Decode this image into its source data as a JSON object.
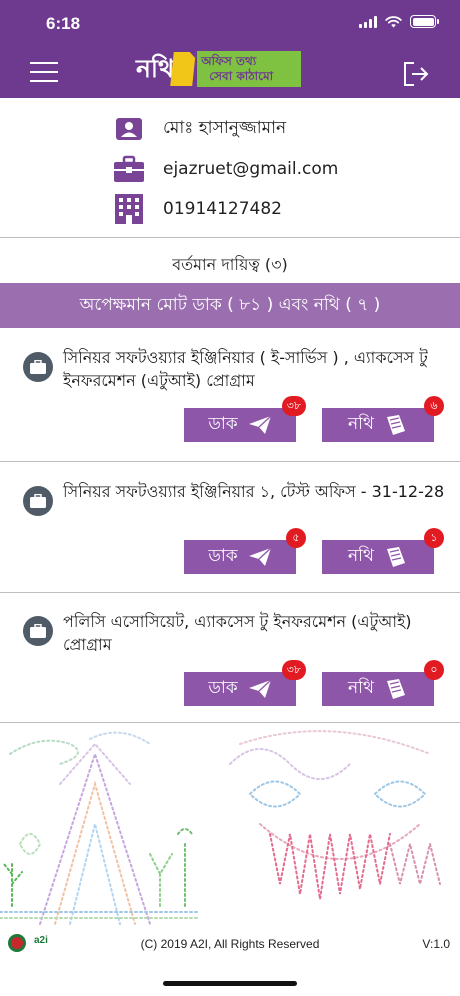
{
  "status_bar": {
    "time": "6:18"
  },
  "header": {
    "logo_main": "নথি",
    "logo_line1": "অফিস তথ্য",
    "logo_line2": "সেবা কাঠামো"
  },
  "profile": {
    "name": "মোঃ হাসানুজ্জামান",
    "email": "ejazruet@gmail.com",
    "phone": "01914127482"
  },
  "current_responsibility": "বর্তমান দায়িত্ব (৩)",
  "pending_summary": "অপেক্ষমান মোট ডাক ( ৮১ ) এবং নথি ( ৭ )",
  "buttons": {
    "dak_label": "ডাক",
    "nothi_label": "নথি"
  },
  "designations": [
    {
      "title": "সিনিয়র সফটওয়্যার ইঞ্জিনিয়ার ( ই-সার্ভিস ) , এ্যাকসেস টু ইনফরমেশন (এটুআই) প্রোগ্রাম",
      "dak_count": "৩৮",
      "nothi_count": "৬"
    },
    {
      "title": "সিনিয়র সফটওয়্যার ইঞ্জিনিয়ার ১, টেস্ট অফিস - 31-12-28",
      "dak_count": "৫",
      "nothi_count": "১"
    },
    {
      "title": "পলিসি এসোসিয়েট, এ্যাকসেস টু ইনফরমেশন (এটুআই) প্রোগ্রাম",
      "dak_count": "৩৮",
      "nothi_count": "০"
    }
  ],
  "footer": {
    "copyright": "(C) 2019 A2I, All Rights Reserved",
    "version": "V:1.0",
    "partner_logo": "a2i"
  },
  "colors": {
    "header": "#6e3a8f",
    "pending_bar": "#9a6eaf",
    "button": "#8e56a8",
    "badge": "#e21b23",
    "logo_yellow": "#f2c618",
    "logo_green": "#7fc241"
  },
  "icons": {
    "menu": "hamburger-icon",
    "logout": "logout-icon",
    "user": "user-card-icon",
    "email": "briefcase-icon",
    "phone": "building-icon",
    "designation": "briefcase-circle-icon",
    "dak": "paper-plane-icon",
    "nothi": "file-icon"
  }
}
